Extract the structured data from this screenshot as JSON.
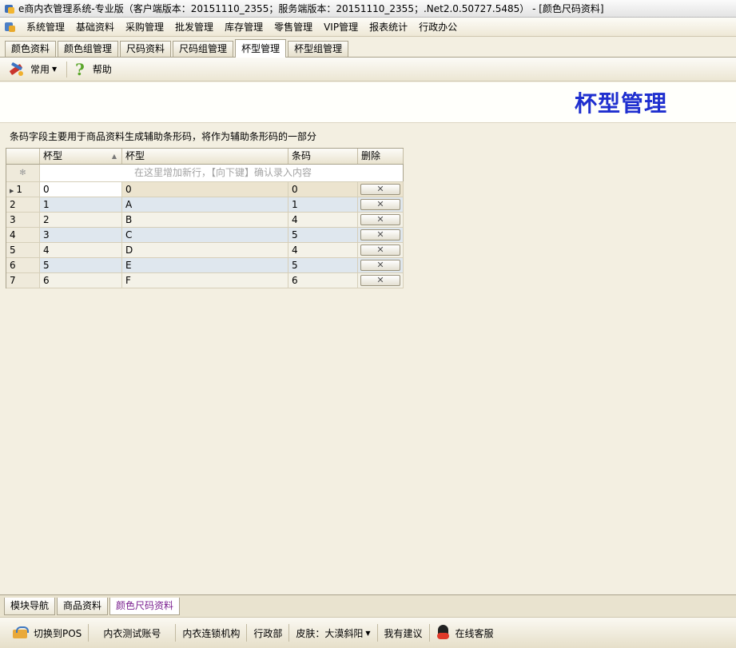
{
  "window": {
    "title": "e商内衣管理系统-专业版（客户端版本：20151110_2355；服务端版本：20151110_2355；.Net2.0.50727.5485） - [颜色尺码资料]"
  },
  "menubar": {
    "items": [
      "系统管理",
      "基础资料",
      "采购管理",
      "批发管理",
      "库存管理",
      "零售管理",
      "VIP管理",
      "报表统计",
      "行政办公"
    ]
  },
  "doc_tabs": {
    "items": [
      "颜色资料",
      "颜色组管理",
      "尺码资料",
      "尺码组管理",
      "杯型管理",
      "杯型组管理"
    ],
    "active_index": 4
  },
  "toolbar": {
    "common_label": "常用",
    "help_label": "帮助"
  },
  "page": {
    "title": "杯型管理",
    "description": "条码字段主要用于商品资料生成辅助条形码，将作为辅助条形码的一部分"
  },
  "grid": {
    "columns": [
      "杯型",
      "杯型",
      "条码",
      "删除"
    ],
    "new_row_indicator": "✻",
    "new_row_hint": "在这里增加新行，【向下键】确认录入内容",
    "delete_symbol": "✕",
    "rows": [
      {
        "num": "1",
        "code": "0",
        "name": "0",
        "barcode": "0"
      },
      {
        "num": "2",
        "code": "1",
        "name": "A",
        "barcode": "1"
      },
      {
        "num": "3",
        "code": "2",
        "name": "B",
        "barcode": "4"
      },
      {
        "num": "4",
        "code": "3",
        "name": "C",
        "barcode": "5"
      },
      {
        "num": "5",
        "code": "4",
        "name": "D",
        "barcode": "4"
      },
      {
        "num": "6",
        "code": "5",
        "name": "E",
        "barcode": "5"
      },
      {
        "num": "7",
        "code": "6",
        "name": "F",
        "barcode": "6"
      }
    ]
  },
  "bottom_tabs": {
    "items": [
      "模块导航",
      "商品资料",
      "颜色尺码资料"
    ],
    "active_index": 2
  },
  "statusbar": {
    "switch_pos": "切换到POS",
    "account": "内衣测试账号",
    "org": "内衣连锁机构",
    "dept": "行政部",
    "skin": "皮肤：大漠斜阳",
    "suggestion": "我有建议",
    "online_service": "在线客服"
  },
  "colors": {
    "title_blue": "#1f2fcf",
    "active_tab_text": "#7a1f8f",
    "background": "#f3efe1"
  }
}
